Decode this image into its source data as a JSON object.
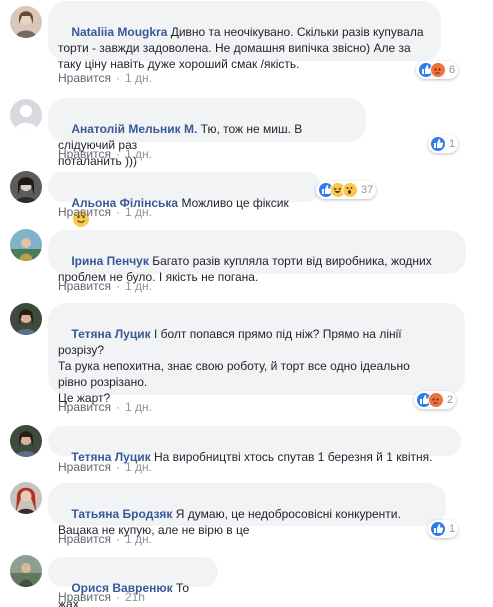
{
  "like_label": "Нравится",
  "separator": "·",
  "colors": {
    "author": "#385898",
    "bubble": "#f2f3f5",
    "meta": "#90949c",
    "like_reaction": "#2e7bf0",
    "angry_reaction": "#f0713a",
    "haha_reaction": "#f7c94a"
  },
  "comments": [
    {
      "author": "Nataliia Mougkra",
      "text": "Дивно та неочікувано. Скільки разів купувала\nторти - завжди задоволена. Не домашня випічка звісно) Але за\nтаку ціну навіть дуже хороший смак /якість.",
      "time": "1 дн.",
      "reactions": [
        "like",
        "angry"
      ],
      "reaction_count": "6"
    },
    {
      "author": "Анатолій Мельник М.",
      "text": "Тю, тож не миш. В слідуючий раз\nпоталанить )))",
      "time": "1 дн.",
      "reactions": [
        "like"
      ],
      "reaction_count": "1"
    },
    {
      "author": "Альона Філінська",
      "text": "Можливо це фіксик",
      "time": "1 дн.",
      "reactions": [
        "like",
        "haha",
        "wow"
      ],
      "reaction_count": "37",
      "emoji": "smiley"
    },
    {
      "author": "Ірина Пенчук",
      "text": "Багато разів купляла торти від виробника, жодних\nпроблем не було. І якість не погана.",
      "time": "1 дн.",
      "reactions": [],
      "reaction_count": ""
    },
    {
      "author": "Тетяна Луцик",
      "text": "І болт попався прямо під ніж? Прямо на лінії\nрозрізу?\nТа рука непохитна, знає свою роботу, й торт все одно ідеально\nрівно розрізано.\nЦе жарт?",
      "time": "1 дн.",
      "reactions": [
        "like",
        "angry"
      ],
      "reaction_count": "2"
    },
    {
      "author": "Тетяна Луцик",
      "text": "На виробництві хтось спутав 1 березня й 1 квітня.",
      "time": "1 дн.",
      "reactions": [],
      "reaction_count": ""
    },
    {
      "author": "Татьяна Бродзяк",
      "text": "Я думаю, це недобросовісні конкуренти.\nВацака не купую, але не вірю в це",
      "time": "1 дн.",
      "reactions": [
        "like"
      ],
      "reaction_count": "1"
    },
    {
      "author": "Орися Вавренюк",
      "text": "То жах",
      "time": "21h",
      "reactions": [],
      "reaction_count": ""
    }
  ]
}
